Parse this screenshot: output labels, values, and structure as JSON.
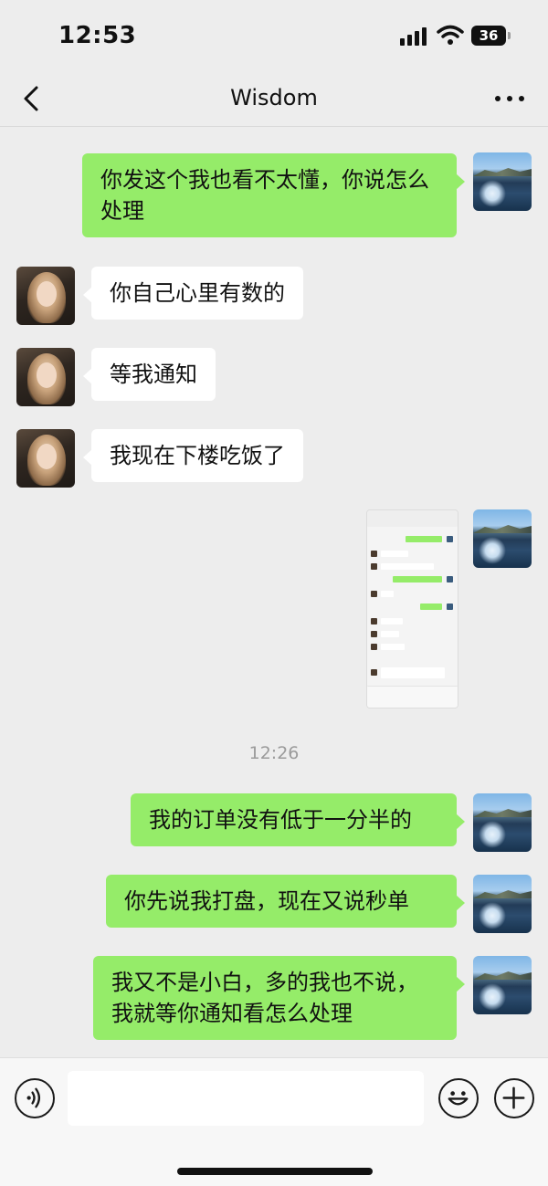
{
  "status_bar": {
    "time": "12:53",
    "battery": "36"
  },
  "header": {
    "title": "Wisdom"
  },
  "messages": {
    "m1": "你发这个我也看不太懂，你说怎么处理",
    "m2": "你自己心里有数的",
    "m3": "等我通知",
    "m4": "我现在下楼吃饭了",
    "time_divider": "12:26",
    "m6": "我的订单没有低于一分半的",
    "m7": "你先说我打盘，现在又说秒单",
    "m8": "我又不是小白，多的我也不说，我就等你通知看怎么处理"
  },
  "input_bar": {
    "value": ""
  },
  "colors": {
    "sent_bubble": "#95ec69",
    "received_bubble": "#ffffff",
    "background": "#ededed"
  },
  "icons": [
    "back-arrow-icon",
    "more-dots-icon",
    "voice-icon",
    "emoji-icon",
    "plus-icon",
    "signal-icon",
    "wifi-icon",
    "battery-icon"
  ]
}
